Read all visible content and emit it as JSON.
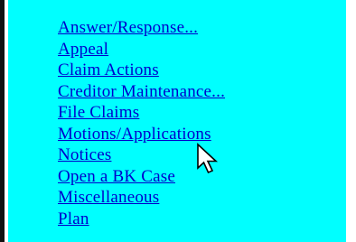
{
  "menu": {
    "items": [
      {
        "label": "Answer/Response..."
      },
      {
        "label": "Appeal"
      },
      {
        "label": "Claim Actions"
      },
      {
        "label": "Creditor Maintenance..."
      },
      {
        "label": "File Claims"
      },
      {
        "label": "Motions/Applications"
      },
      {
        "label": "Notices"
      },
      {
        "label": "Open a BK Case"
      },
      {
        "label": "Miscellaneous"
      },
      {
        "label": "Plan"
      }
    ]
  },
  "colors": {
    "panel_background": "#00ffff",
    "link": "#0000cc",
    "left_border": "#111111"
  },
  "icons": {
    "cursor": "mouse-pointer-icon"
  }
}
